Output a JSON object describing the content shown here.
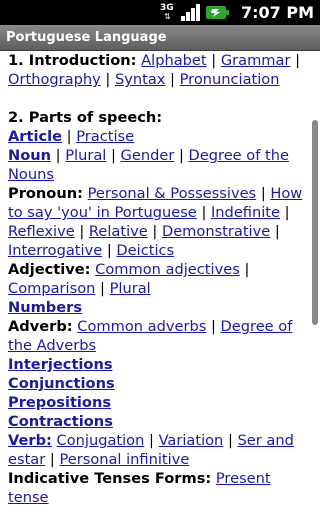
{
  "status_bar": {
    "network_label": "3G",
    "time": "7:07 PM"
  },
  "app": {
    "title": "Portuguese Language"
  },
  "sections": {
    "intro": {
      "heading": "1. Introduction:",
      "links": [
        "Alphabet",
        "Grammar",
        "Orthography",
        "Syntax",
        "Pronunciation"
      ]
    },
    "parts_heading": "2. Parts of speech:",
    "article": {
      "label": "Article",
      "links": [
        "Practise"
      ]
    },
    "noun": {
      "label": "Noun",
      "links": [
        "Plural",
        "Gender",
        "Degree of the Nouns"
      ]
    },
    "pronoun": {
      "label": "Pronoun:",
      "links": [
        "Personal & Possessives",
        "How to say 'you' in Portuguese",
        "Indefinite",
        "Reflexive",
        "Relative",
        "Demonstrative",
        "Interrogative",
        "Deictics"
      ]
    },
    "adjective": {
      "label": "Adjective:",
      "links": [
        "Common adjectives",
        "Comparison",
        "Plural"
      ]
    },
    "numbers": {
      "label": "Numbers"
    },
    "adverb": {
      "label": "Adverb:",
      "links": [
        "Common adverbs",
        "Degree of the Adverbs"
      ]
    },
    "interjections": {
      "label": "Interjections"
    },
    "conjunctions": {
      "label": "Conjunctions"
    },
    "prepositions": {
      "label": "Prepositions"
    },
    "contractions": {
      "label": "Contractions"
    },
    "verb": {
      "label": "Verb:",
      "links": [
        "Conjugation",
        "Variation",
        "Ser and estar",
        "Personal infinitive"
      ]
    },
    "indicative": {
      "label": "Indicative Tenses Forms:",
      "links": [
        "Present tense"
      ]
    }
  },
  "separator": "|",
  "colors": {
    "link": "#1a1aa6",
    "title_bar": "#6e6e6e",
    "status_bar": "#000000"
  }
}
